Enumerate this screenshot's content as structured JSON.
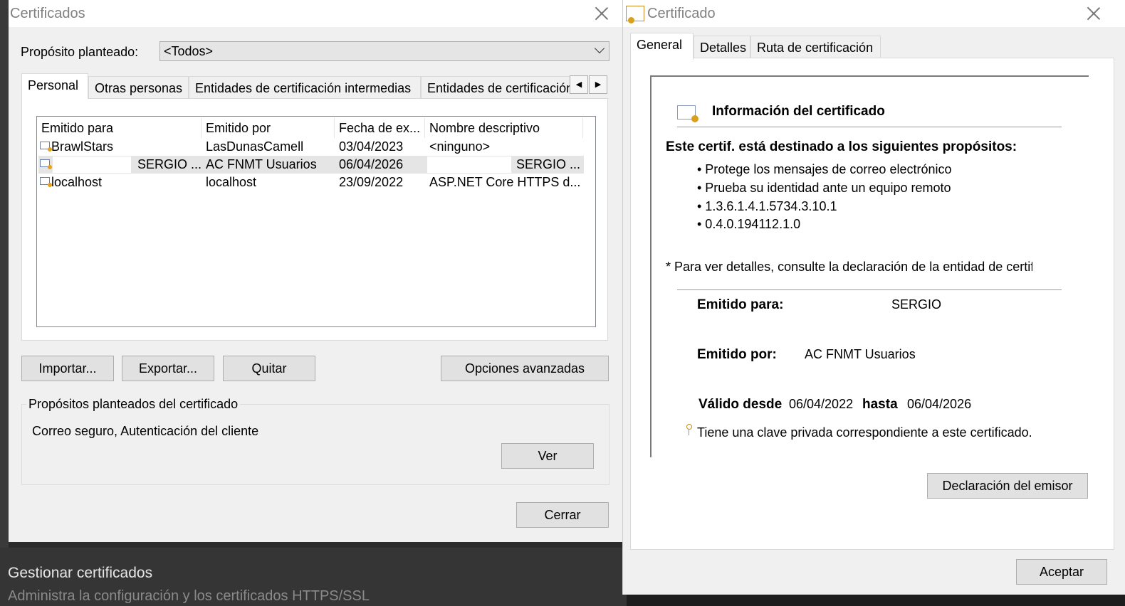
{
  "background": {
    "title": "Gestionar certificados",
    "subtitle": "Administra la configuración y los certificados HTTPS/SSL"
  },
  "left_window": {
    "title": "Certificados",
    "purpose_label": "Propósito planteado:",
    "purpose_value": "<Todos>",
    "tabs": [
      {
        "label": "Personal"
      },
      {
        "label": "Otras personas"
      },
      {
        "label": "Entidades de certificación intermedias"
      },
      {
        "label": "Entidades de certificación raíz de confianza"
      }
    ],
    "columns": [
      "Emitido para",
      "Emitido por",
      "Fecha de ex...",
      "Nombre descriptivo"
    ],
    "rows": [
      {
        "issued_to": "BrawlStars",
        "issued_by": "LasDunasCamell",
        "expires": "03/04/2023",
        "friendly_name": "<ninguno>"
      },
      {
        "issued_to": "SERGIO ...",
        "issued_by": "AC FNMT Usuarios",
        "expires": "06/04/2026",
        "friendly_name": "SERGIO ..."
      },
      {
        "issued_to": "localhost",
        "issued_by": "localhost",
        "expires": "23/09/2022",
        "friendly_name": "ASP.NET Core HTTPS d..."
      }
    ],
    "buttons": {
      "import": "Importar...",
      "export": "Exportar...",
      "remove": "Quitar",
      "advanced": "Opciones avanzadas",
      "view": "Ver",
      "close": "Cerrar"
    },
    "purposes_group_title": "Propósitos planteados del certificado",
    "purposes_group_value": "Correo seguro, Autenticación del cliente"
  },
  "right_window": {
    "title": "Certificado",
    "tabs": [
      {
        "label": "General"
      },
      {
        "label": "Detalles"
      },
      {
        "label": "Ruta de certificación"
      }
    ],
    "info_heading": "Información del certificado",
    "purposes_heading": "Este certif. está destinado a los siguientes propósitos:",
    "purposes": [
      "• Protege los mensajes de correo electrónico",
      "• Prueba su identidad ante un equipo remoto",
      "• 1.3.6.1.4.1.5734.3.10.1",
      "• 0.4.0.194112.1.0"
    ],
    "note": "* Para ver detalles, consulte la declaración de la entidad de certificación.",
    "issued_to_label": "Emitido para:",
    "issued_to_value": "SERGIO",
    "issued_by_label": "Emitido por:",
    "issued_by_value": "AC FNMT Usuarios",
    "valid_from_label": "Válido desde",
    "valid_from_value": "06/04/2022",
    "valid_to_label": "hasta",
    "valid_to_value": "06/04/2026",
    "private_key_text": "Tiene una clave privada correspondiente a este certificado.",
    "buttons": {
      "issuer_statement": "Declaración del emisor",
      "accept": "Aceptar"
    }
  }
}
